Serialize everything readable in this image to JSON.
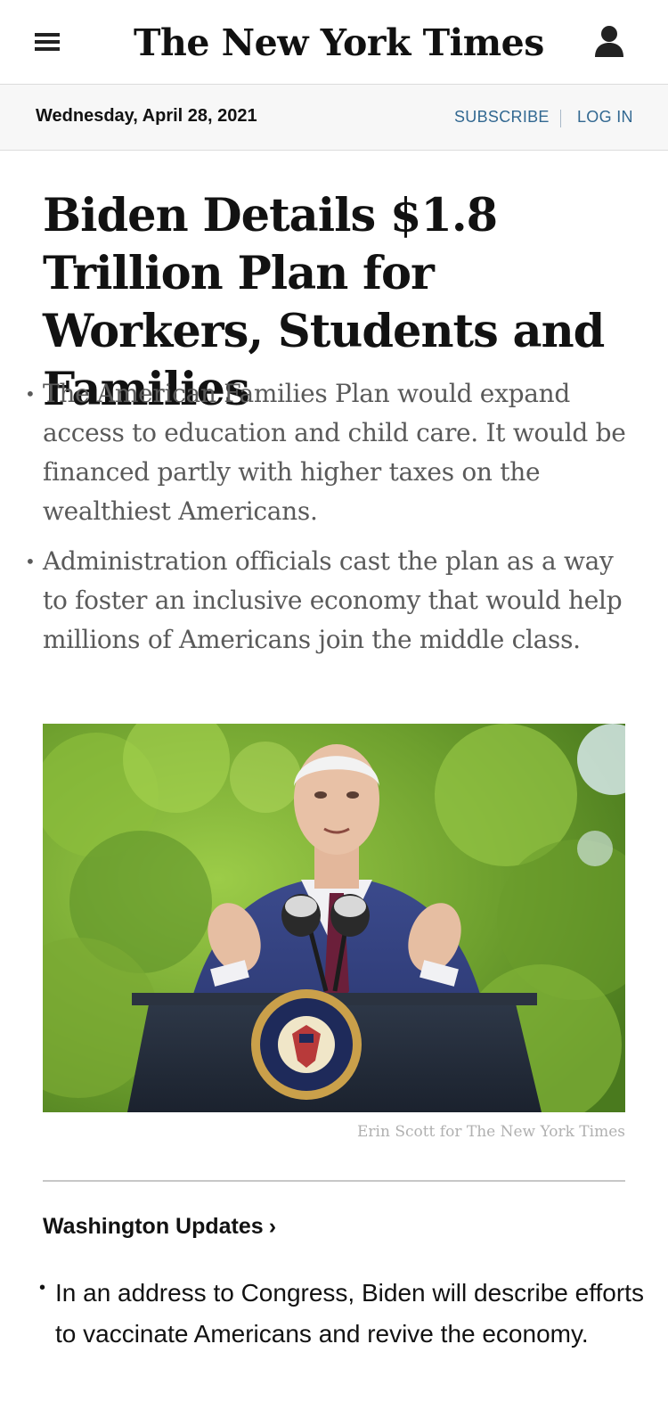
{
  "masthead": {
    "logo_text": "The New York Times",
    "menu_icon": "hamburger-menu-icon",
    "account_icon": "person-icon"
  },
  "date_bar": {
    "date": "Wednesday, April 28, 2021",
    "subscribe_label": "SUBSCRIBE",
    "login_label": "LOG IN"
  },
  "article": {
    "headline": "Biden Details $1.8 Trillion Plan for Workers, Students and Families",
    "summary": [
      "The American Families Plan would expand access to education and child care. It would be financed partly with higher taxes on the wealthiest Americans.",
      "Administration officials cast the plan as a way to foster an inclusive economy that would help millions of Americans join the middle class."
    ],
    "photo_credit": "Erin Scott for The New York Times"
  },
  "section": {
    "title": "Washington Updates",
    "chevron": "›",
    "items": [
      "In an address to Congress, Biden will describe efforts to vaccinate Americans and revive the economy."
    ]
  },
  "colors": {
    "link_blue": "#326891",
    "headline": "#121212",
    "summary_gray": "#5a5a5a",
    "date_bar_bg": "#f7f7f7"
  }
}
